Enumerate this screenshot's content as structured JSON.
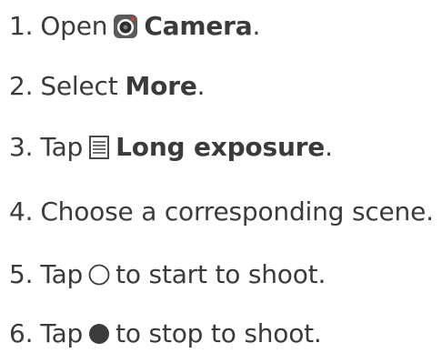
{
  "steps": [
    {
      "number": "1.",
      "text_before": "Open",
      "icon": "camera-app-icon",
      "bold": "Camera",
      "text_after": "."
    },
    {
      "number": "2.",
      "text_before": "Select",
      "bold": "More",
      "text_after": "."
    },
    {
      "number": "3.",
      "text_before": "Tap",
      "icon": "long-exposure-icon",
      "bold": "Long exposure",
      "text_after": "."
    },
    {
      "number": "4.",
      "text_before": "Choose a corresponding scene."
    },
    {
      "number": "5.",
      "text_before": "Tap",
      "icon": "shutter-outline-icon",
      "text_after": "to start to shoot."
    },
    {
      "number": "6.",
      "text_before": "Tap",
      "icon": "shutter-filled-icon",
      "text_after": "to stop to shoot."
    }
  ]
}
